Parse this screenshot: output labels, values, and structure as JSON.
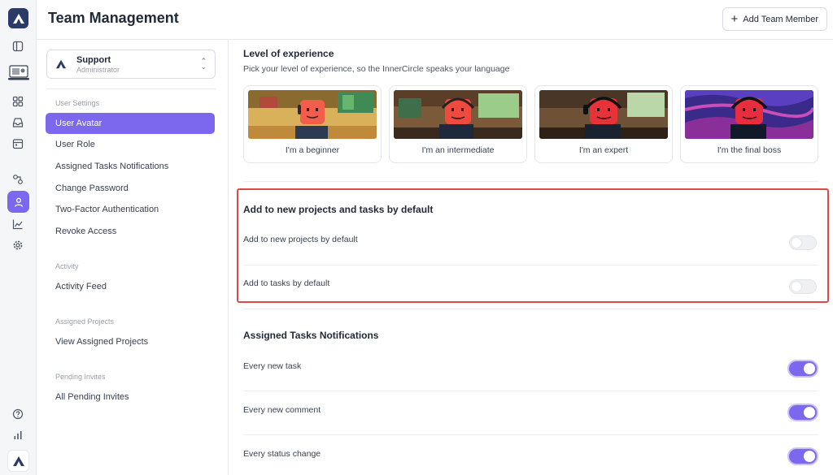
{
  "header": {
    "title": "Team Management",
    "add_member_label": "Add Team Member"
  },
  "account": {
    "name": "Support",
    "role": "Administrator"
  },
  "nav": {
    "sections": [
      {
        "title": "User Settings",
        "items": [
          "User Avatar",
          "User Role",
          "Assigned Tasks Notifications",
          "Change Password",
          "Two-Factor Authentication",
          "Revoke Access"
        ]
      },
      {
        "title": "Activity",
        "items": [
          "Activity Feed"
        ]
      },
      {
        "title": "Assigned Projects",
        "items": [
          "View Assigned Projects"
        ]
      },
      {
        "title": "Pending Invites",
        "items": [
          "All Pending Invites"
        ]
      }
    ],
    "active_item": "User Avatar"
  },
  "experience": {
    "title": "Level of experience",
    "subtitle": "Pick your level of experience, so the InnerCircle speaks your language",
    "levels": [
      {
        "label": "I'm a beginner"
      },
      {
        "label": "I'm an intermediate"
      },
      {
        "label": "I'm an expert"
      },
      {
        "label": "I'm the final boss"
      }
    ]
  },
  "defaults": {
    "title": "Add to new projects and tasks by default",
    "rows": [
      {
        "label": "Add to new projects by default",
        "on": false
      },
      {
        "label": "Add to tasks by default",
        "on": false
      }
    ]
  },
  "notifications": {
    "title": "Assigned Tasks Notifications",
    "rows": [
      {
        "label": "Every new task",
        "on": true
      },
      {
        "label": "Every new comment",
        "on": true
      },
      {
        "label": "Every status change",
        "on": true
      }
    ]
  },
  "colors": {
    "accent": "#7b68ee",
    "highlight": "#e04848",
    "rail_logo": "#2b3a67"
  },
  "icons": [
    "panel-icon",
    "workspace-illustration-icon",
    "grid-icon",
    "inbox-icon",
    "calendar-icon",
    "integrations-icon",
    "user-icon",
    "chart-line-icon",
    "gear-icon",
    "help-icon",
    "bar-chart-icon"
  ]
}
